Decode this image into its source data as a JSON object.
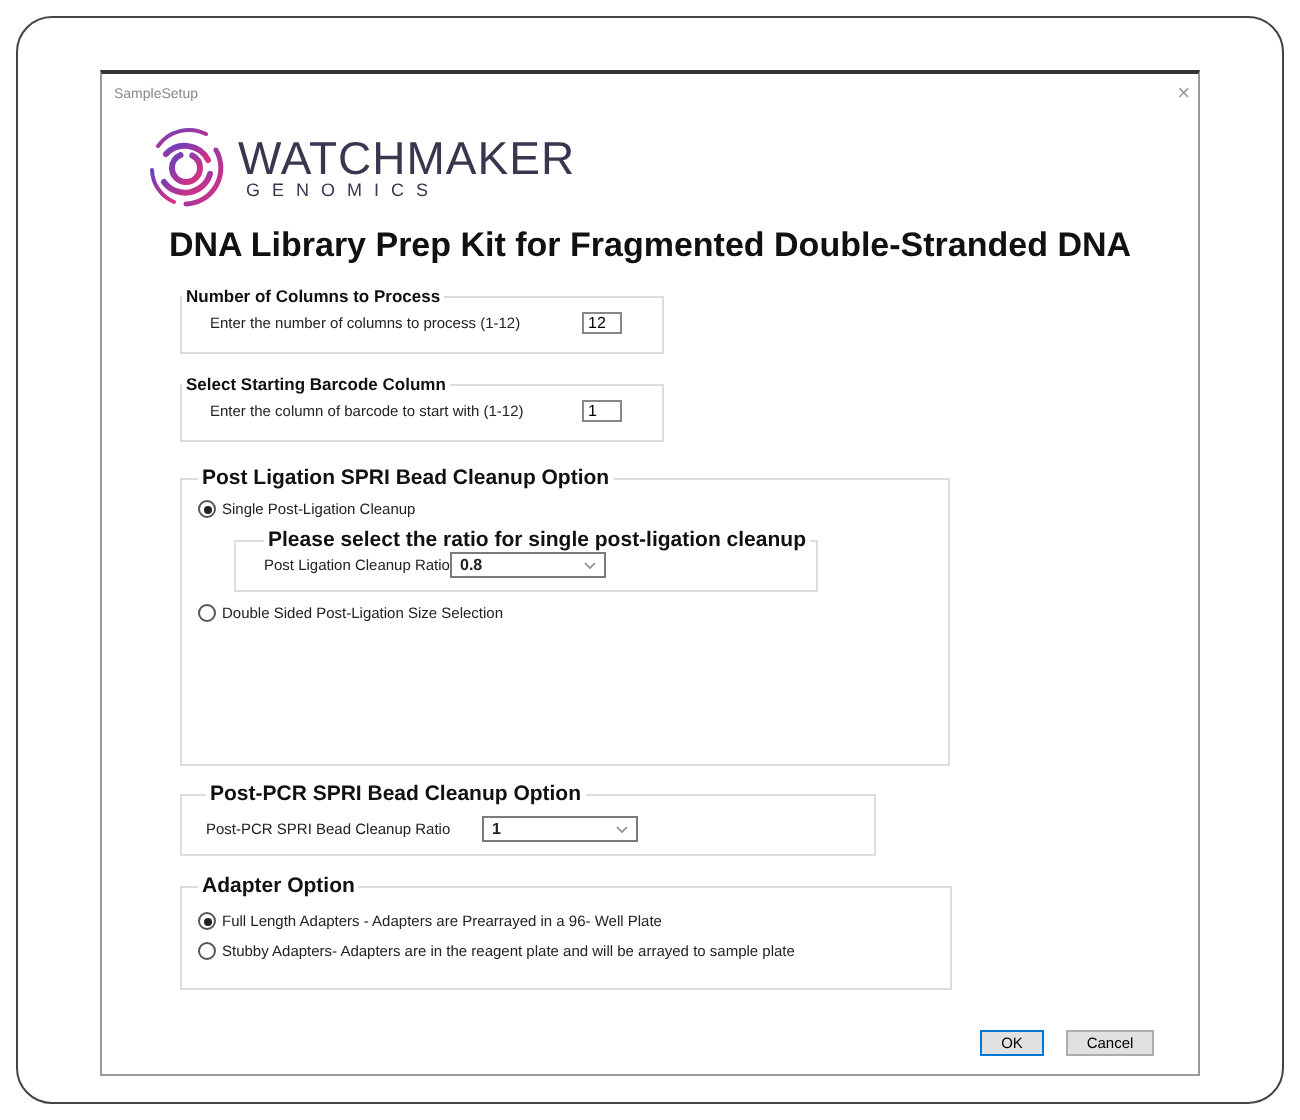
{
  "window": {
    "title": "SampleSetup",
    "close": "×"
  },
  "logo": {
    "name": "WATCHMAKER",
    "subtitle": "GENOMICS"
  },
  "heading": "DNA Library Prep Kit for Fragmented Double-Stranded DNA",
  "columns_group": {
    "title": "Number of Columns to Process",
    "label": "Enter the number of columns to process (1-12)",
    "value": "12"
  },
  "barcode_group": {
    "title": "Select Starting Barcode Column",
    "label": "Enter the column of barcode to start with (1-12)",
    "value": "1"
  },
  "ligation_group": {
    "title": "Post Ligation SPRI Bead Cleanup Option",
    "options": [
      {
        "label": "Single Post-Ligation Cleanup",
        "selected": true
      },
      {
        "label": "Double Sided Post-Ligation Size Selection",
        "selected": false
      }
    ],
    "ratio_group": {
      "title": "Please select the ratio for single post-ligation cleanup",
      "label": "Post Ligation Cleanup Ratio",
      "value": "0.8"
    }
  },
  "pcr_group": {
    "title": "Post-PCR SPRI Bead Cleanup Option",
    "label": "Post-PCR SPRI Bead Cleanup Ratio",
    "value": "1"
  },
  "adapter_group": {
    "title": "Adapter Option",
    "options": [
      {
        "label": "Full Length Adapters - Adapters are Prearrayed in a 96- Well Plate",
        "selected": true
      },
      {
        "label": "Stubby Adapters- Adapters are in the reagent plate and will be arrayed to sample plate",
        "selected": false
      }
    ]
  },
  "buttons": [
    {
      "label": "OK",
      "default": true
    },
    {
      "label": "Cancel",
      "default": false
    }
  ]
}
